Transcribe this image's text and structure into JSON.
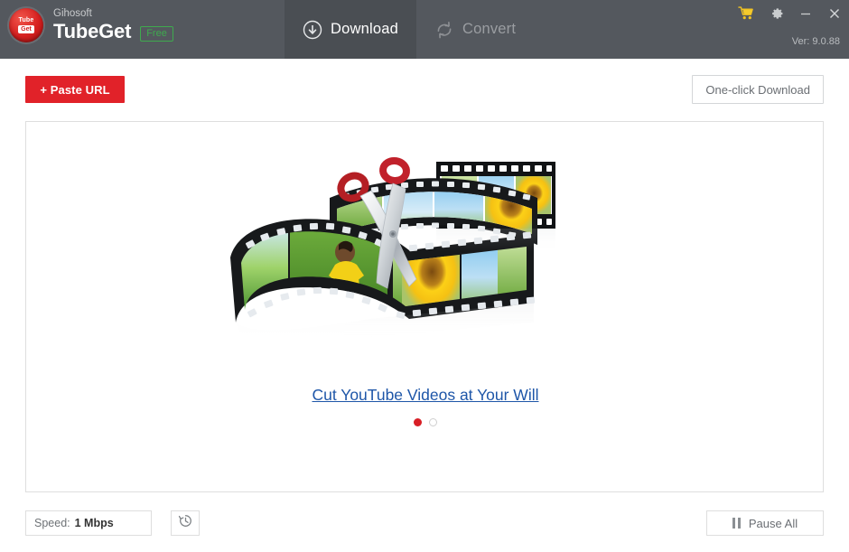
{
  "window": {
    "brand_sub": "Gihosoft",
    "brand_main": "TubeGet",
    "badge": "Free",
    "version": "Ver: 9.0.88",
    "controls": {
      "cart": "cart-icon",
      "settings": "gear-icon",
      "minimize": "minimize-icon",
      "close": "close-icon"
    }
  },
  "tabs": [
    {
      "label": "Download",
      "icon": "download-circle-icon",
      "active": true
    },
    {
      "label": "Convert",
      "icon": "refresh-circle-icon",
      "active": false
    }
  ],
  "toolbar": {
    "paste_url_label": "+ Paste URL",
    "one_click_label": "One-click Download"
  },
  "promo": {
    "link_text": "Cut YouTube Videos at Your Will",
    "image_alt": "filmstrip-with-scissors",
    "dots": [
      {
        "active": true
      },
      {
        "active": false
      }
    ]
  },
  "statusbar": {
    "speed_label": "Speed:",
    "speed_value": "1 Mbps",
    "history_icon": "history-clock-icon",
    "pause_all_label": "Pause All",
    "pause_icon": "pause-icon"
  },
  "colors": {
    "titlebar": "#54585e",
    "tab_active": "#4a4e53",
    "accent_red": "#e12229",
    "badge_green": "#3faa4e",
    "link_blue": "#1e56a8",
    "panel_border": "#dedede"
  }
}
